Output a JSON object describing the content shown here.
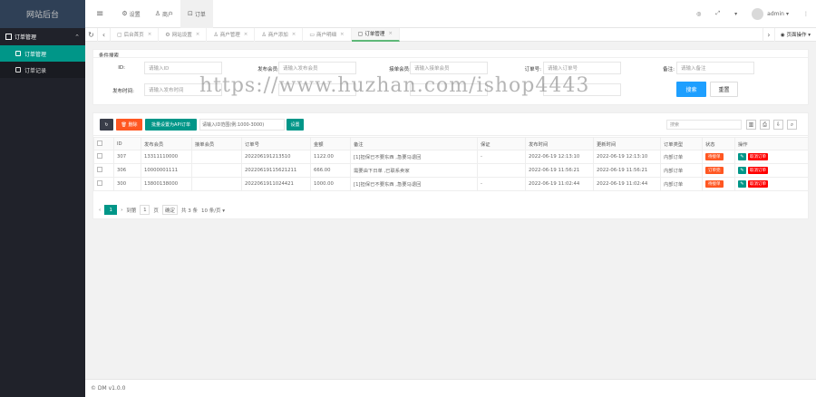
{
  "app": {
    "title": "网站后台"
  },
  "sidebar": {
    "group_label": "订单管理",
    "items": [
      {
        "label": "订单管理",
        "active": true
      },
      {
        "label": "订单记录",
        "active": false
      }
    ]
  },
  "header": {
    "menu_icon": "≡",
    "links": [
      {
        "label": "设置",
        "icon": "gear-icon"
      },
      {
        "label": "商户",
        "icon": "user-icon"
      },
      {
        "label": "订单",
        "icon": "order-icon"
      }
    ],
    "user": "admin"
  },
  "tabs": [
    {
      "label": "后台首页",
      "active": false
    },
    {
      "label": "网站设置",
      "active": false
    },
    {
      "label": "商户管理",
      "active": false
    },
    {
      "label": "商户添加",
      "active": false
    },
    {
      "label": "商户明细",
      "active": false
    },
    {
      "label": "订单管理",
      "active": true
    }
  ],
  "tabs_ops": "页面操作",
  "search": {
    "title": "条件搜索",
    "fields": {
      "id": {
        "label": "ID:",
        "placeholder": "请输入ID"
      },
      "publisher": {
        "label": "发布会员:",
        "placeholder": "请输入发布会员"
      },
      "receiver": {
        "label": "接单会员:",
        "placeholder": "请输入接单会员"
      },
      "order_no": {
        "label": "订单号:",
        "placeholder": "请输入订单号"
      },
      "remark": {
        "label": "备注:",
        "placeholder": "请输入备注"
      },
      "time": {
        "label": "发布时间:",
        "placeholder": "请输入发布时间"
      }
    },
    "search_btn": "搜索",
    "reset_btn": "重置"
  },
  "toolbar": {
    "delete": "删除",
    "batch": "批量设置为API订单",
    "id_input_placeholder": "请输入ID范围(例:1000-3000)",
    "send": "设置",
    "search_placeholder": "搜索"
  },
  "table": {
    "headers": [
      "ID",
      "发布会员",
      "接单会员",
      "订单号",
      "金额",
      "备注",
      "保证",
      "发布时间",
      "更新时间",
      "订单类型",
      "状态",
      "操作"
    ],
    "rows": [
      {
        "id": "307",
        "publisher": "13311110000",
        "receiver": "",
        "order_no": "202206191213510",
        "amount": "1122.00",
        "remark": "[1]担保已不要东西 ,急要马退回",
        "guarantee": "-",
        "created": "2022-06-19 12:13:10",
        "updated": "2022-06-19 12:13:10",
        "type": "内部订单",
        "status": "待接单",
        "edit": "✎",
        "del": "取消订单"
      },
      {
        "id": "306",
        "publisher": "10000001111",
        "receiver": "",
        "order_no": "20220619115621211",
        "amount": "666.00",
        "remark": "需要由下日单 ,已联系卖家",
        "guarantee": "",
        "created": "2022-06-19 11:56:21",
        "updated": "2022-06-19 11:56:21",
        "type": "内部订单",
        "status": "订单完",
        "edit": "✎",
        "del": "取消订单"
      },
      {
        "id": "300",
        "publisher": "13800138000",
        "receiver": "",
        "order_no": "2022061911024421",
        "amount": "1000.00",
        "remark": "[1]担保已不要东西 ,急要马退回",
        "guarantee": "-",
        "created": "2022-06-19 11:02:44",
        "updated": "2022-06-19 11:02:44",
        "type": "内部订单",
        "status": "待接单",
        "edit": "✎",
        "del": "取消订单"
      }
    ]
  },
  "pager": {
    "current": "1",
    "goto_label": "到第",
    "goto_value": "1",
    "page_unit": "页",
    "confirm": "确定",
    "total": "共 3 条",
    "per_page": "10 条/页"
  },
  "watermark": "https://www.huzhan.com/ishop4443",
  "footer": "© DM v1.0.0"
}
